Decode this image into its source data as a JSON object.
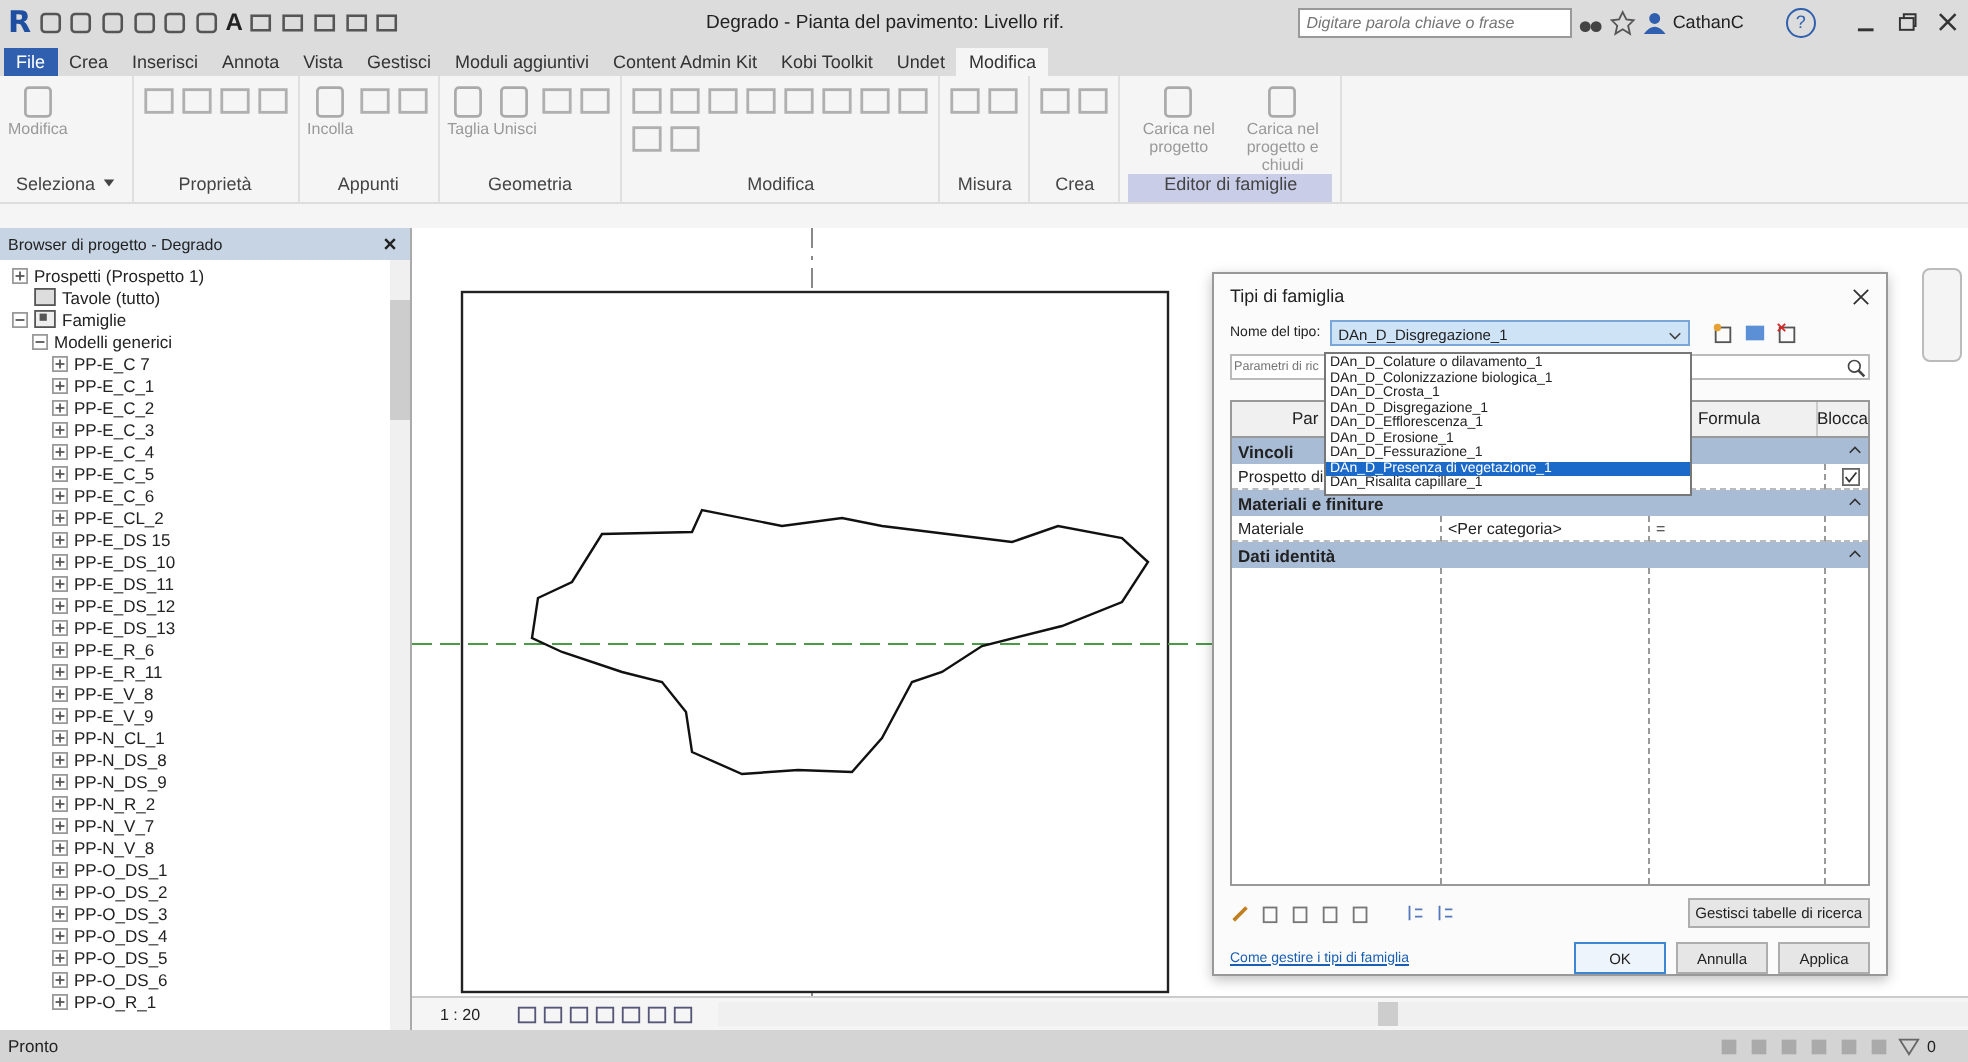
{
  "app_logo": "R",
  "quick_access": {
    "text_tool": "A"
  },
  "window": {
    "title": "Degrado - Pianta del pavimento: Livello rif."
  },
  "search": {
    "placeholder": "Digitare parola chiave o frase"
  },
  "user": {
    "name": "CathanC"
  },
  "help": "?",
  "ribbon_tabs": [
    {
      "label": "File",
      "selected": false
    },
    {
      "label": "Crea",
      "selected": false
    },
    {
      "label": "Inserisci",
      "selected": false
    },
    {
      "label": "Annota",
      "selected": false
    },
    {
      "label": "Vista",
      "selected": false
    },
    {
      "label": "Gestisci",
      "selected": false
    },
    {
      "label": "Moduli aggiuntivi",
      "selected": false
    },
    {
      "label": "Content Admin Kit",
      "selected": false
    },
    {
      "label": "Kobi Toolkit",
      "selected": false
    },
    {
      "label": "Undet",
      "selected": false
    },
    {
      "label": "Modifica",
      "selected": true
    }
  ],
  "ribbon_panels": [
    {
      "title": "Seleziona",
      "dropdown": true,
      "highlighted": false,
      "items": [
        "Modifica"
      ]
    },
    {
      "title": "Proprietà",
      "dropdown": false,
      "highlighted": false
    },
    {
      "title": "Appunti",
      "dropdown": false,
      "highlighted": false,
      "items": [
        "Incolla"
      ]
    },
    {
      "title": "Geometria",
      "dropdown": false,
      "highlighted": false,
      "items": [
        "Taglia",
        "Unisci"
      ]
    },
    {
      "title": "Modifica",
      "dropdown": false,
      "highlighted": false
    },
    {
      "title": "Misura",
      "dropdown": false,
      "highlighted": false
    },
    {
      "title": "Crea",
      "dropdown": false,
      "highlighted": false
    },
    {
      "title": "Editor di famiglie",
      "dropdown": false,
      "highlighted": true,
      "items": [
        "Carica nel progetto",
        "Carica nel progetto e chiudi"
      ]
    }
  ],
  "browser": {
    "title": "Browser di progetto - Degrado",
    "tree": [
      {
        "label": "Prospetti (Prospetto 1)",
        "expanded": false
      },
      {
        "label": "Tavole (tutto)"
      },
      {
        "label": "Famiglie",
        "expanded": true,
        "children": [
          {
            "label": "Modelli generici",
            "expanded": true,
            "children": [
              {
                "label": "PP-E_C 7",
                "expanded": false
              },
              {
                "label": "PP-E_C_1",
                "expanded": false
              },
              {
                "label": "PP-E_C_2",
                "expanded": false
              },
              {
                "label": "PP-E_C_3",
                "expanded": false
              },
              {
                "label": "PP-E_C_4",
                "expanded": false
              },
              {
                "label": "PP-E_C_5",
                "expanded": false
              },
              {
                "label": "PP-E_C_6",
                "expanded": false
              },
              {
                "label": "PP-E_CL_2",
                "expanded": false
              },
              {
                "label": "PP-E_DS 15",
                "expanded": false
              },
              {
                "label": "PP-E_DS_10",
                "expanded": false
              },
              {
                "label": "PP-E_DS_11",
                "expanded": false
              },
              {
                "label": "PP-E_DS_12",
                "expanded": false
              },
              {
                "label": "PP-E_DS_13",
                "expanded": false
              },
              {
                "label": "PP-E_R_6",
                "expanded": false
              },
              {
                "label": "PP-E_R_11",
                "expanded": false
              },
              {
                "label": "PP-E_V_8",
                "expanded": false
              },
              {
                "label": "PP-E_V_9",
                "expanded": false
              },
              {
                "label": "PP-N_CL_1",
                "expanded": false
              },
              {
                "label": "PP-N_DS_8",
                "expanded": false
              },
              {
                "label": "PP-N_DS_9",
                "expanded": false
              },
              {
                "label": "PP-N_R_2",
                "expanded": false
              },
              {
                "label": "PP-N_V_7",
                "expanded": false
              },
              {
                "label": "PP-N_V_8",
                "expanded": false
              },
              {
                "label": "PP-O_DS_1",
                "expanded": false
              },
              {
                "label": "PP-O_DS_2",
                "expanded": false
              },
              {
                "label": "PP-O_DS_3",
                "expanded": false
              },
              {
                "label": "PP-O_DS_4",
                "expanded": false
              },
              {
                "label": "PP-O_DS_5",
                "expanded": false
              },
              {
                "label": "PP-O_DS_6",
                "expanded": false
              },
              {
                "label": "PP-O_R_1",
                "expanded": false
              }
            ]
          }
        ]
      }
    ]
  },
  "view": {
    "scale": "1 : 20"
  },
  "dialog": {
    "title": "Tipi di famiglia",
    "type_label": "Nome del tipo:",
    "type_value": "DAn_D_Disgregazione_1",
    "type_options": [
      {
        "label": "DAn_D_Colature o dilavamento_1",
        "selected": false
      },
      {
        "label": "DAn_D_Colonizzazione biologica_1",
        "selected": false
      },
      {
        "label": "DAn_D_Crosta_1",
        "selected": false
      },
      {
        "label": "DAn_D_Disgregazione_1",
        "selected": false
      },
      {
        "label": "DAn_D_Efflorescenza_1",
        "selected": false
      },
      {
        "label": "DAn_D_Erosione_1",
        "selected": false
      },
      {
        "label": "DAn_D_Fessurazione_1",
        "selected": false
      },
      {
        "label": "DAn_D_Presenza di vegetazione_1",
        "selected": true
      },
      {
        "label": "DAn_Risalita capillare_1",
        "selected": false
      }
    ],
    "search_placeholder": "Parametri di ric",
    "columns": [
      "Par",
      "Formula",
      "Blocca"
    ],
    "groups": [
      {
        "title": "Vincoli",
        "rows": [
          {
            "parameter": "Prospetto di",
            "value": "",
            "formula": "",
            "checked": true
          }
        ]
      },
      {
        "title": "Materiali e finiture",
        "rows": [
          {
            "parameter": "Materiale",
            "value": "<Per categoria>",
            "formula": "="
          }
        ]
      },
      {
        "title": "Dati identità"
      }
    ],
    "lookup_button": "Gestisci tabelle di ricerca",
    "help_link": "Come gestire i tipi di famiglia",
    "buttons": [
      {
        "label": "OK",
        "selected": true
      },
      {
        "label": "Annulla",
        "selected": false
      },
      {
        "label": "Applica",
        "selected": false
      }
    ]
  },
  "status_bar": {
    "text": "Pronto",
    "filter_count": "0"
  }
}
